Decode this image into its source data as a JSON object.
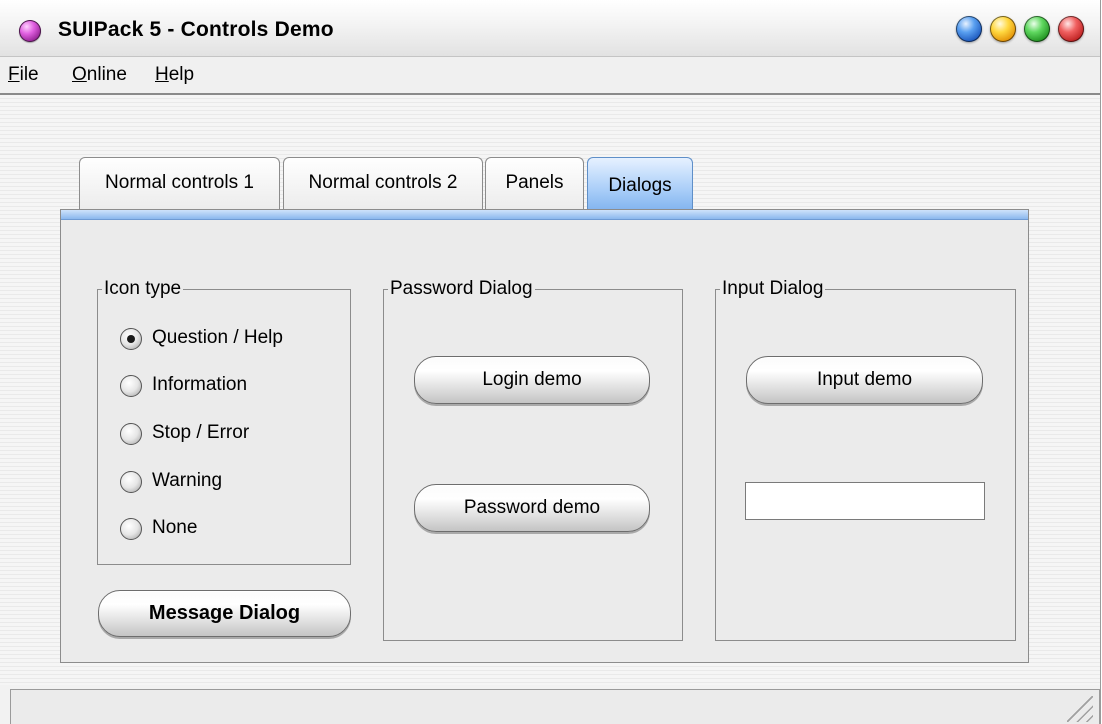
{
  "window": {
    "title": "SUIPack 5 - Controls Demo"
  },
  "menu": [
    "File",
    "Online",
    "Help"
  ],
  "tabs": [
    "Normal controls 1",
    "Normal controls 2",
    "Panels",
    "Dialogs"
  ],
  "active_tab": "Dialogs",
  "icon_type": {
    "label": "Icon type",
    "options": [
      "Question / Help",
      "Information",
      "Stop / Error",
      "Warning",
      "None"
    ],
    "selected": "Question / Help"
  },
  "message_button": "Message Dialog",
  "password_dialog": {
    "label": "Password Dialog",
    "login_button": "Login demo",
    "password_button": "Password demo"
  },
  "input_dialog": {
    "label": "Input Dialog",
    "input_button": "Input demo",
    "input_value": ""
  },
  "colors": {
    "active_tab": "#8bb8ee",
    "panel_accent": "#a8cdf8"
  }
}
